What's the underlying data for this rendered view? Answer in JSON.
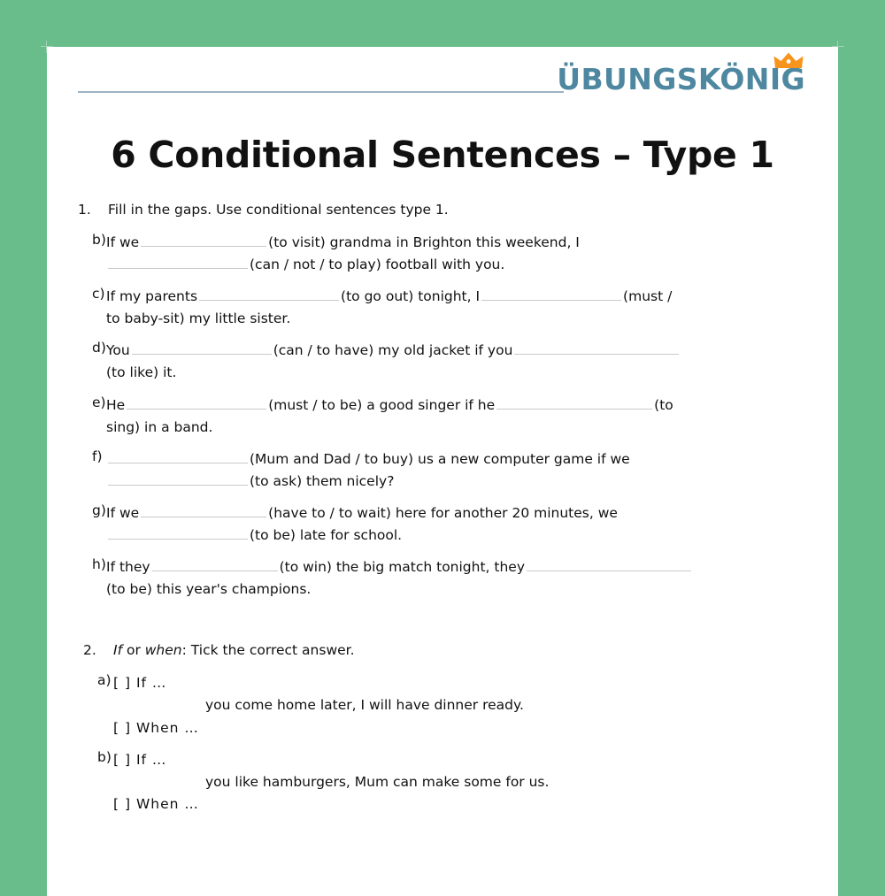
{
  "theme": {
    "background_color": "#68bd8b",
    "page_color": "#ffffff",
    "logo_color": "#4e87a0",
    "crown_color": "#f7941d",
    "rule_color": "#9cb3c4",
    "blank_line_color": "#c9c9c9"
  },
  "header": {
    "logo_text": "ÜBUNGSKÖNIG",
    "crown_icon": "crown-icon",
    "rule": "horizontal-rule"
  },
  "title": "6 Conditional Sentences – Type 1",
  "exercises": [
    {
      "number": "1.",
      "instruction": "Fill in the gaps. Use conditional sentences type 1.",
      "items": [
        {
          "label": "b)",
          "line1_pre": "If we",
          "line1_post": "(to visit) grandma in Brighton this weekend, I",
          "line2_post": "(can / not / to play) football with you."
        },
        {
          "label": "c)",
          "line1_pre": "If my parents",
          "line1_mid": "(to go out) tonight, I",
          "line1_post": "(must /",
          "line2_post": "to baby-sit) my little sister."
        },
        {
          "label": "d)",
          "line1_pre": "You",
          "line1_mid": "(can / to have) my old jacket if you",
          "line2_post": "(to like) it."
        },
        {
          "label": "e)",
          "line1_pre": "He",
          "line1_mid": "(must / to be) a good singer if he",
          "line1_post": "(to",
          "line2_post": "sing) in a band."
        },
        {
          "label": "f)",
          "line1_post": "(Mum and Dad / to buy) us a new computer game if we",
          "line2_post": "(to ask) them nicely?"
        },
        {
          "label": "g)",
          "line1_pre": "If we",
          "line1_post": "(have to / to wait) here for another 20 minutes, we",
          "line2_post": "(to be) late for school."
        },
        {
          "label": "h)",
          "line1_pre": "If they",
          "line1_mid": "(to win) the big match tonight, they",
          "line2_post": "(to be) this year's champions."
        }
      ]
    },
    {
      "number": "2.",
      "instruction_part1": "If",
      "instruction_part2": " or ",
      "instruction_part3": "when",
      "instruction_part4": ": Tick the correct answer.",
      "items": [
        {
          "label": "a)",
          "option1": "[   ] If …",
          "sentence": "you come home later, I will have dinner ready.",
          "option2": "[   ] When …"
        },
        {
          "label": "b)",
          "option1": "[   ] If …",
          "sentence": "you like hamburgers, Mum can make some for us.",
          "option2": "[   ] When …"
        }
      ]
    }
  ]
}
